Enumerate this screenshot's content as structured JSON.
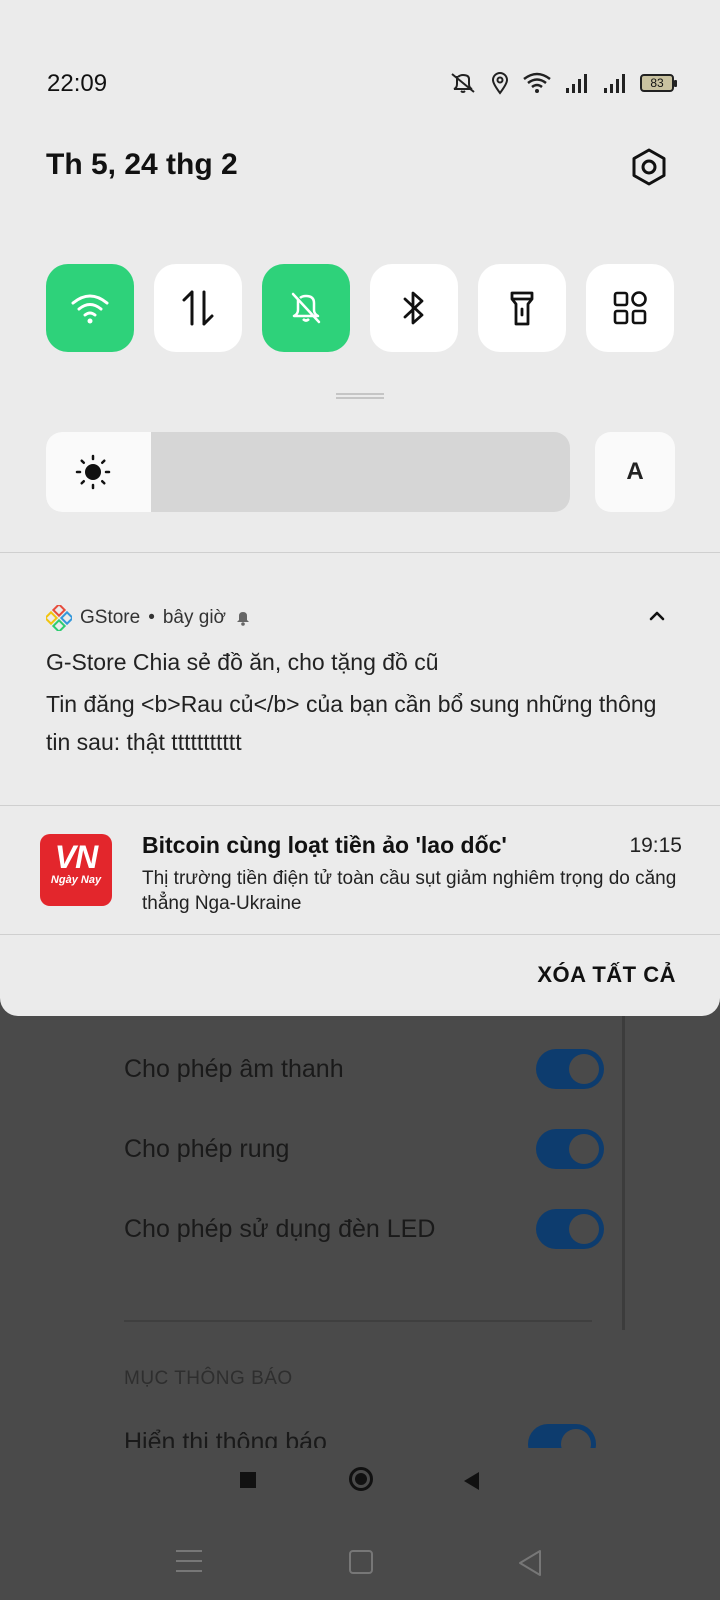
{
  "status_bar": {
    "time": "22:09",
    "battery": "83",
    "icons": [
      "mute-icon",
      "location-icon",
      "wifi-icon",
      "signal-icon",
      "signal-icon",
      "battery-icon"
    ]
  },
  "shade": {
    "date": "Th 5, 24 thg 2",
    "quick_tiles": [
      {
        "name": "wifi",
        "icon": "wifi-icon",
        "active": true
      },
      {
        "name": "mobile-data",
        "icon": "data-arrows-icon",
        "active": false
      },
      {
        "name": "silent",
        "icon": "bell-off-icon",
        "active": true
      },
      {
        "name": "bluetooth",
        "icon": "bluetooth-icon",
        "active": false
      },
      {
        "name": "flashlight",
        "icon": "flashlight-icon",
        "active": false
      },
      {
        "name": "more",
        "icon": "grid-icon",
        "active": false
      }
    ],
    "brightness_level": 0.2,
    "auto_brightness_label": "A"
  },
  "notifications": [
    {
      "app": "GStore",
      "when": "bây giờ",
      "title": "G-Store Chia sẻ đồ ăn, cho tặng đồ cũ",
      "body": "Tin đăng <b>Rau củ</b> của bạn cần bổ sung những thông tin sau: thật ttttttttttt"
    },
    {
      "logo_text": "VN",
      "logo_subtext": "Ngày Nay",
      "title": "Bitcoin cùng loạt tiền ảo 'lao dốc'",
      "time": "19:15",
      "body": "Thị trường tiền điện tử toàn cầu sụt giảm nghiêm trọng do căng thẳng Nga-Ukraine"
    }
  ],
  "clear_all_label": "XÓA TẤT CẢ",
  "background_app": {
    "rows": [
      {
        "label": "Cho phép âm thanh",
        "on": true
      },
      {
        "label": "Cho phép rung",
        "on": true
      },
      {
        "label": "Cho phép sử dụng đèn LED",
        "on": true
      }
    ],
    "section_header": "MỤC THÔNG BÁO",
    "partial_row": "Hiển thị thông báo"
  },
  "colors": {
    "accent_green": "#2ed27a",
    "vn_red": "#e3262c",
    "toggle_blue": "#0d3c6e"
  }
}
